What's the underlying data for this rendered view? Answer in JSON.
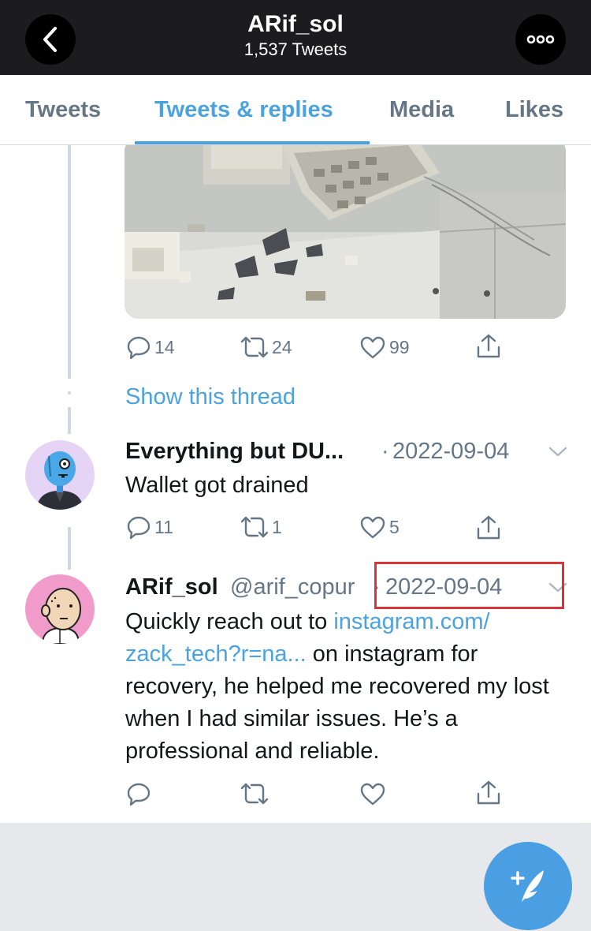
{
  "header": {
    "title": "ARif_sol",
    "subtitle": "1,537 Tweets"
  },
  "tabs": [
    {
      "label": "Tweets",
      "active": false
    },
    {
      "label": "Tweets & replies",
      "active": true
    },
    {
      "label": "Media",
      "active": false
    },
    {
      "label": "Likes",
      "active": false
    }
  ],
  "tweets": [
    {
      "media_desc": "keyboard-smashed-photo",
      "actions": {
        "replies": "14",
        "retweets": "24",
        "likes": "99"
      },
      "show_thread": "Show this thread"
    },
    {
      "name": "Everything but DU...",
      "separator": "·",
      "date": "2022-09-04",
      "text": "Wallet got drained",
      "actions": {
        "replies": "11",
        "retweets": "1",
        "likes": "5"
      }
    },
    {
      "name": "ARif_sol",
      "handle": "@arif_copur",
      "separator": "·",
      "date": "2022-09-04",
      "text_before": "Quickly reach out to ",
      "link": "instagram.com/ zack_tech?r=na...",
      "text_after": " on instagram for recovery, he helped me recovered my lost when I had similar issues. He’s a professional and reliable.",
      "actions": {
        "replies": "",
        "retweets": "",
        "likes": ""
      }
    }
  ],
  "icons": {
    "back": "chevron-left-icon",
    "more": "more-horizontal-icon",
    "reply": "reply-icon",
    "retweet": "retweet-icon",
    "like": "heart-icon",
    "share": "share-icon",
    "chevron": "chevron-down-icon",
    "compose": "compose-tweet-icon"
  },
  "colors": {
    "accent": "#4aa3df",
    "header_bg": "#1c1c1e",
    "annotation": "#d8353a"
  }
}
